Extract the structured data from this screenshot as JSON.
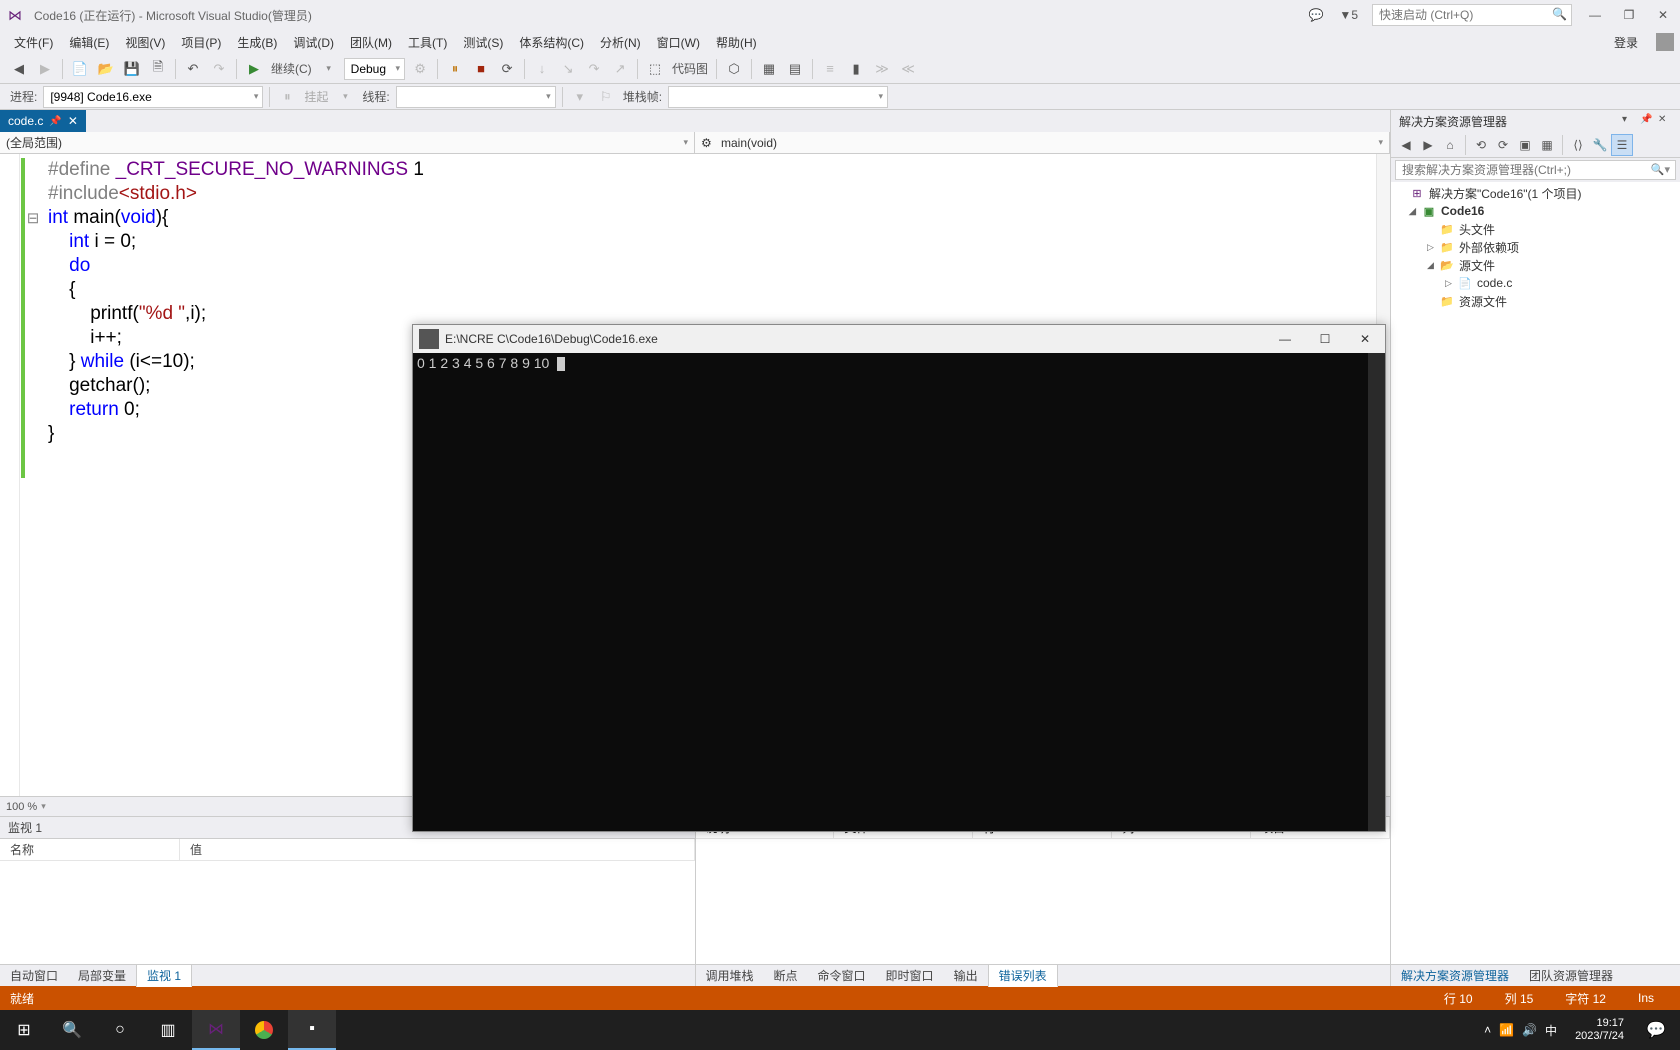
{
  "titlebar": {
    "title": "Code16 (正在运行) - Microsoft Visual Studio(管理员)",
    "flag_count": "5",
    "quick_launch_placeholder": "快速启动 (Ctrl+Q)"
  },
  "menubar": {
    "items": [
      "文件(F)",
      "编辑(E)",
      "视图(V)",
      "项目(P)",
      "生成(B)",
      "调试(D)",
      "团队(M)",
      "工具(T)",
      "测试(S)",
      "体系结构(C)",
      "分析(N)",
      "窗口(W)",
      "帮助(H)"
    ],
    "login": "登录"
  },
  "toolbar": {
    "continue_label": "继续(C)",
    "config": "Debug",
    "codemap_label": "代码图"
  },
  "toolbar2": {
    "process_label": "进程:",
    "process_value": "[9948] Code16.exe",
    "suspend_label": "挂起",
    "thread_label": "线程:",
    "stackframe_label": "堆栈帧:"
  },
  "filetab": {
    "name": "code.c"
  },
  "navbar": {
    "scope": "(全局范围)",
    "member": "main(void)"
  },
  "code_lines": [
    {
      "t": "pp",
      "s": "#define "
    },
    {
      "t": "mac",
      "s": "_CRT_SECURE_NO_WARNINGS"
    },
    {
      "t": "",
      "s": " "
    },
    {
      "t": "num",
      "s": "1"
    },
    {
      "t": "nl"
    },
    {
      "t": "pp",
      "s": "#include"
    },
    {
      "t": "inc",
      "s": "<stdio.h>"
    },
    {
      "t": "nl"
    },
    {
      "t": "kw",
      "s": "int"
    },
    {
      "t": "",
      "s": " main("
    },
    {
      "t": "kw",
      "s": "void"
    },
    {
      "t": "",
      "s": "){"
    },
    {
      "t": "nl"
    },
    {
      "t": "",
      "s": "    "
    },
    {
      "t": "kw",
      "s": "int"
    },
    {
      "t": "",
      "s": " i = 0;"
    },
    {
      "t": "nl"
    },
    {
      "t": "",
      "s": "    "
    },
    {
      "t": "kw",
      "s": "do"
    },
    {
      "t": "nl"
    },
    {
      "t": "",
      "s": "    {"
    },
    {
      "t": "nl"
    },
    {
      "t": "",
      "s": "        printf("
    },
    {
      "t": "str",
      "s": "\"%d \""
    },
    {
      "t": "",
      "s": ",i);"
    },
    {
      "t": "nl"
    },
    {
      "t": "",
      "s": "        i++;"
    },
    {
      "t": "nl"
    },
    {
      "t": "",
      "s": "    } "
    },
    {
      "t": "kw",
      "s": "while"
    },
    {
      "t": "",
      "s": " (i<=10);"
    },
    {
      "t": "nl"
    },
    {
      "t": "",
      "s": "    getchar();"
    },
    {
      "t": "nl"
    },
    {
      "t": "",
      "s": "    "
    },
    {
      "t": "kw",
      "s": "return"
    },
    {
      "t": "",
      "s": " 0;"
    },
    {
      "t": "nl"
    },
    {
      "t": "",
      "s": "}"
    },
    {
      "t": "nl"
    }
  ],
  "zoom": "100 %",
  "watch": {
    "title": "监视 1",
    "cols": [
      "名称",
      "值"
    ]
  },
  "bottom_tabs_left": [
    "自动窗口",
    "局部变量",
    "监视 1"
  ],
  "bottom_right_cols": [
    "说明",
    "文件",
    "行",
    "列",
    "项目"
  ],
  "bottom_tabs_right": [
    "调用堆栈",
    "断点",
    "命令窗口",
    "即时窗口",
    "输出",
    "错误列表"
  ],
  "side": {
    "title": "解决方案资源管理器",
    "search_placeholder": "搜索解决方案资源管理器(Ctrl+;)",
    "solution": "解决方案\"Code16\"(1 个项目)",
    "project": "Code16",
    "folders": {
      "headers": "头文件",
      "external": "外部依赖项",
      "sources": "源文件",
      "resources": "资源文件"
    },
    "file": "code.c",
    "tabs": [
      "解决方案资源管理器",
      "团队资源管理器"
    ]
  },
  "statusbar": {
    "ready": "就绪",
    "line": "行 10",
    "col": "列 15",
    "char": "字符 12",
    "ins": "Ins"
  },
  "console": {
    "title": "E:\\NCRE C\\Code16\\Debug\\Code16.exe",
    "output": "0 1 2 3 4 5 6 7 8 9 10 "
  },
  "taskbar": {
    "ime": "中",
    "time": "19:17",
    "date": "2023/7/24"
  }
}
